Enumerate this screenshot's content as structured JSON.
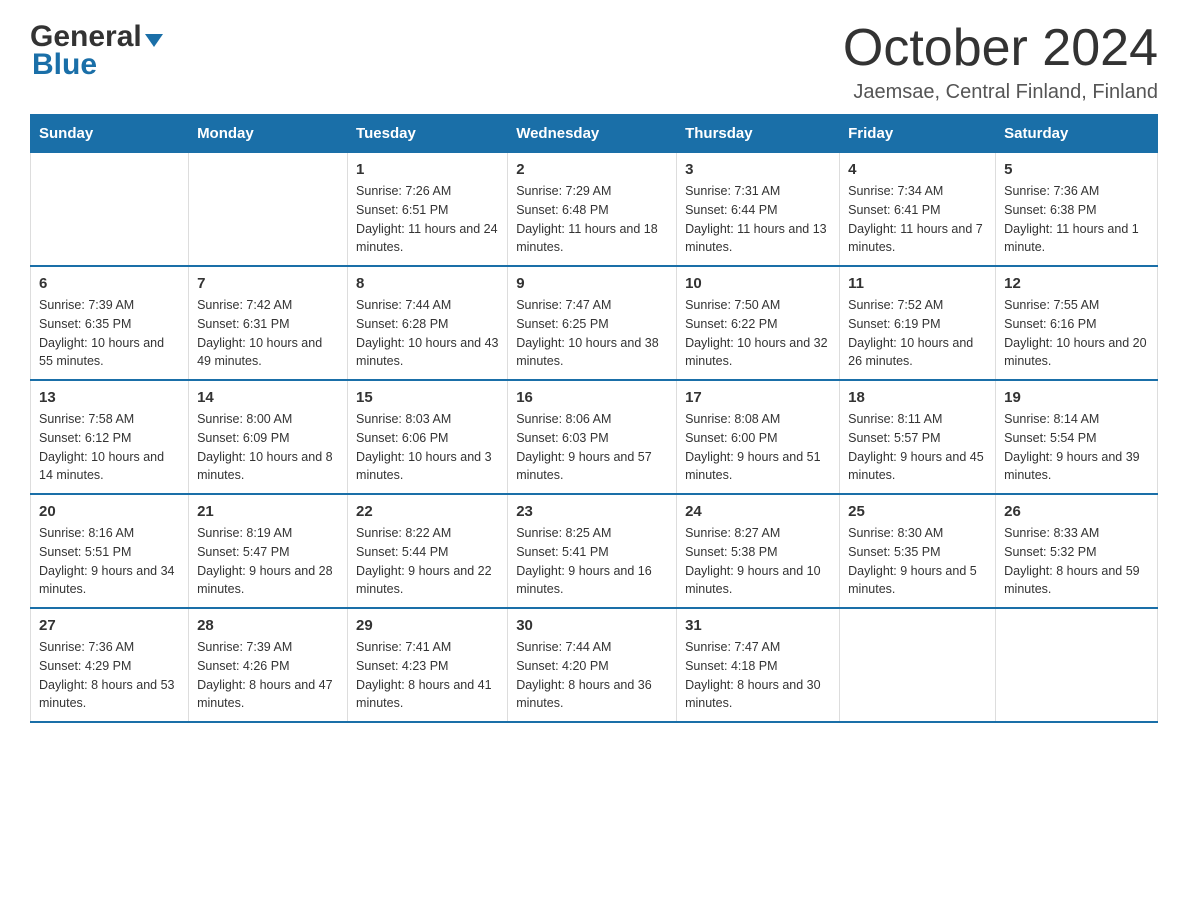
{
  "logo": {
    "general": "General",
    "blue": "Blue",
    "arrow": "▼"
  },
  "title": "October 2024",
  "subtitle": "Jaemsae, Central Finland, Finland",
  "headers": [
    "Sunday",
    "Monday",
    "Tuesday",
    "Wednesday",
    "Thursday",
    "Friday",
    "Saturday"
  ],
  "weeks": [
    [
      {
        "day": "",
        "sunrise": "",
        "sunset": "",
        "daylight": ""
      },
      {
        "day": "",
        "sunrise": "",
        "sunset": "",
        "daylight": ""
      },
      {
        "day": "1",
        "sunrise": "Sunrise: 7:26 AM",
        "sunset": "Sunset: 6:51 PM",
        "daylight": "Daylight: 11 hours and 24 minutes."
      },
      {
        "day": "2",
        "sunrise": "Sunrise: 7:29 AM",
        "sunset": "Sunset: 6:48 PM",
        "daylight": "Daylight: 11 hours and 18 minutes."
      },
      {
        "day": "3",
        "sunrise": "Sunrise: 7:31 AM",
        "sunset": "Sunset: 6:44 PM",
        "daylight": "Daylight: 11 hours and 13 minutes."
      },
      {
        "day": "4",
        "sunrise": "Sunrise: 7:34 AM",
        "sunset": "Sunset: 6:41 PM",
        "daylight": "Daylight: 11 hours and 7 minutes."
      },
      {
        "day": "5",
        "sunrise": "Sunrise: 7:36 AM",
        "sunset": "Sunset: 6:38 PM",
        "daylight": "Daylight: 11 hours and 1 minute."
      }
    ],
    [
      {
        "day": "6",
        "sunrise": "Sunrise: 7:39 AM",
        "sunset": "Sunset: 6:35 PM",
        "daylight": "Daylight: 10 hours and 55 minutes."
      },
      {
        "day": "7",
        "sunrise": "Sunrise: 7:42 AM",
        "sunset": "Sunset: 6:31 PM",
        "daylight": "Daylight: 10 hours and 49 minutes."
      },
      {
        "day": "8",
        "sunrise": "Sunrise: 7:44 AM",
        "sunset": "Sunset: 6:28 PM",
        "daylight": "Daylight: 10 hours and 43 minutes."
      },
      {
        "day": "9",
        "sunrise": "Sunrise: 7:47 AM",
        "sunset": "Sunset: 6:25 PM",
        "daylight": "Daylight: 10 hours and 38 minutes."
      },
      {
        "day": "10",
        "sunrise": "Sunrise: 7:50 AM",
        "sunset": "Sunset: 6:22 PM",
        "daylight": "Daylight: 10 hours and 32 minutes."
      },
      {
        "day": "11",
        "sunrise": "Sunrise: 7:52 AM",
        "sunset": "Sunset: 6:19 PM",
        "daylight": "Daylight: 10 hours and 26 minutes."
      },
      {
        "day": "12",
        "sunrise": "Sunrise: 7:55 AM",
        "sunset": "Sunset: 6:16 PM",
        "daylight": "Daylight: 10 hours and 20 minutes."
      }
    ],
    [
      {
        "day": "13",
        "sunrise": "Sunrise: 7:58 AM",
        "sunset": "Sunset: 6:12 PM",
        "daylight": "Daylight: 10 hours and 14 minutes."
      },
      {
        "day": "14",
        "sunrise": "Sunrise: 8:00 AM",
        "sunset": "Sunset: 6:09 PM",
        "daylight": "Daylight: 10 hours and 8 minutes."
      },
      {
        "day": "15",
        "sunrise": "Sunrise: 8:03 AM",
        "sunset": "Sunset: 6:06 PM",
        "daylight": "Daylight: 10 hours and 3 minutes."
      },
      {
        "day": "16",
        "sunrise": "Sunrise: 8:06 AM",
        "sunset": "Sunset: 6:03 PM",
        "daylight": "Daylight: 9 hours and 57 minutes."
      },
      {
        "day": "17",
        "sunrise": "Sunrise: 8:08 AM",
        "sunset": "Sunset: 6:00 PM",
        "daylight": "Daylight: 9 hours and 51 minutes."
      },
      {
        "day": "18",
        "sunrise": "Sunrise: 8:11 AM",
        "sunset": "Sunset: 5:57 PM",
        "daylight": "Daylight: 9 hours and 45 minutes."
      },
      {
        "day": "19",
        "sunrise": "Sunrise: 8:14 AM",
        "sunset": "Sunset: 5:54 PM",
        "daylight": "Daylight: 9 hours and 39 minutes."
      }
    ],
    [
      {
        "day": "20",
        "sunrise": "Sunrise: 8:16 AM",
        "sunset": "Sunset: 5:51 PM",
        "daylight": "Daylight: 9 hours and 34 minutes."
      },
      {
        "day": "21",
        "sunrise": "Sunrise: 8:19 AM",
        "sunset": "Sunset: 5:47 PM",
        "daylight": "Daylight: 9 hours and 28 minutes."
      },
      {
        "day": "22",
        "sunrise": "Sunrise: 8:22 AM",
        "sunset": "Sunset: 5:44 PM",
        "daylight": "Daylight: 9 hours and 22 minutes."
      },
      {
        "day": "23",
        "sunrise": "Sunrise: 8:25 AM",
        "sunset": "Sunset: 5:41 PM",
        "daylight": "Daylight: 9 hours and 16 minutes."
      },
      {
        "day": "24",
        "sunrise": "Sunrise: 8:27 AM",
        "sunset": "Sunset: 5:38 PM",
        "daylight": "Daylight: 9 hours and 10 minutes."
      },
      {
        "day": "25",
        "sunrise": "Sunrise: 8:30 AM",
        "sunset": "Sunset: 5:35 PM",
        "daylight": "Daylight: 9 hours and 5 minutes."
      },
      {
        "day": "26",
        "sunrise": "Sunrise: 8:33 AM",
        "sunset": "Sunset: 5:32 PM",
        "daylight": "Daylight: 8 hours and 59 minutes."
      }
    ],
    [
      {
        "day": "27",
        "sunrise": "Sunrise: 7:36 AM",
        "sunset": "Sunset: 4:29 PM",
        "daylight": "Daylight: 8 hours and 53 minutes."
      },
      {
        "day": "28",
        "sunrise": "Sunrise: 7:39 AM",
        "sunset": "Sunset: 4:26 PM",
        "daylight": "Daylight: 8 hours and 47 minutes."
      },
      {
        "day": "29",
        "sunrise": "Sunrise: 7:41 AM",
        "sunset": "Sunset: 4:23 PM",
        "daylight": "Daylight: 8 hours and 41 minutes."
      },
      {
        "day": "30",
        "sunrise": "Sunrise: 7:44 AM",
        "sunset": "Sunset: 4:20 PM",
        "daylight": "Daylight: 8 hours and 36 minutes."
      },
      {
        "day": "31",
        "sunrise": "Sunrise: 7:47 AM",
        "sunset": "Sunset: 4:18 PM",
        "daylight": "Daylight: 8 hours and 30 minutes."
      },
      {
        "day": "",
        "sunrise": "",
        "sunset": "",
        "daylight": ""
      },
      {
        "day": "",
        "sunrise": "",
        "sunset": "",
        "daylight": ""
      }
    ]
  ]
}
